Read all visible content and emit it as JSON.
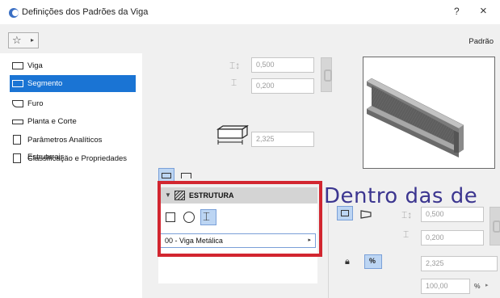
{
  "window": {
    "title": "Definições dos Padrões da Viga",
    "help_label": "?",
    "close_label": "×"
  },
  "toolbar": {
    "favorites_icon": "star-icon",
    "favorites_glyph": "☆",
    "favorites_arrow": "▸",
    "preset_name": "Padrão"
  },
  "sidebar": {
    "items": [
      {
        "label": "Viga",
        "icon": "beam-icon",
        "selected": false
      },
      {
        "label": "Segmento",
        "icon": "segment-icon",
        "selected": true
      },
      {
        "label": "Furo",
        "icon": "hole-icon",
        "selected": false
      },
      {
        "label": "Planta e Corte",
        "icon": "floor-plan-icon",
        "selected": false
      },
      {
        "label": "Parâmetros Analíticos Estruturais",
        "icon": "structural-analytics-icon",
        "selected": false
      },
      {
        "label": "Classificação e Propriedades",
        "icon": "classification-icon",
        "selected": false
      }
    ]
  },
  "geometry": {
    "width_value": "0,500",
    "height_value": "0,200",
    "length_value": "2,325"
  },
  "structure": {
    "header": "ESTRUTURA",
    "collapse_arrow": "▼",
    "profile_value": "00 - Viga Metálica",
    "profile_caret": "▸"
  },
  "overlay": {
    "text": "Dentro das de"
  },
  "right_panel": {
    "width_value": "0,500",
    "height_value": "0,200",
    "length_value": "2,325",
    "percent_value": "100,00",
    "percent_unit": "%",
    "percent_toggle_label": "%",
    "caret": "▸"
  },
  "colors": {
    "selection": "#1a74d4",
    "highlight_border": "#d22630",
    "overlay_text": "#3c3690",
    "toggle_on": "#bcd5f3"
  }
}
